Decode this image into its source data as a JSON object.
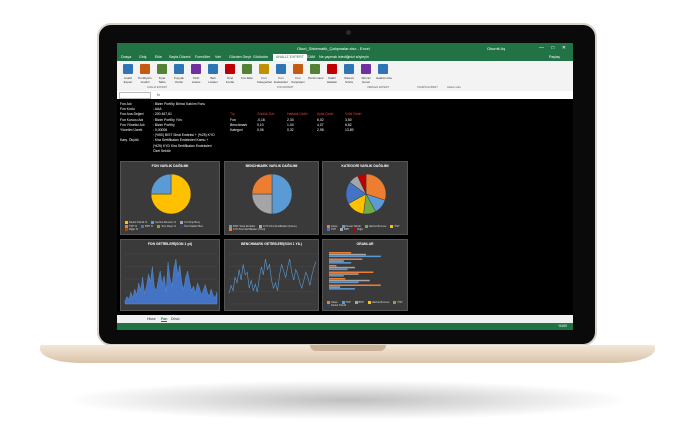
{
  "window": {
    "title": "Okuri_Sistematik_Çalışmalar.xlsx - Excel",
    "user": "Okumit Aş",
    "controls": "— □ ✕"
  },
  "ribbon": {
    "tabs": [
      "Dosya",
      "Giriş",
      "Ekle",
      "Sayfa Düzeni",
      "Formüller",
      "Veri",
      "Gözden Geçir",
      "Görünüm",
      "ANALİZ EXPERT",
      "TEAM"
    ],
    "active_tab": "ANALİZ EXPERT",
    "tell_me": "Ne yapmak istediğinizi söyleyin",
    "share": "Paylaş",
    "buttons": [
      {
        "label": "Analiz Expert",
        "icon": "chart-icon",
        "color": "#2e75b6"
      },
      {
        "label": "Portföyüm Analizi",
        "icon": "pie-icon",
        "color": "#c55a11"
      },
      {
        "label": "Fiyat Tablo",
        "icon": "table-icon",
        "color": "#548235"
      },
      {
        "label": "Kopyalı Veriler",
        "icon": "copy-icon",
        "color": "#2e75b6"
      },
      {
        "label": "Tarih Listesi",
        "icon": "calendar-icon",
        "color": "#7030a0"
      },
      {
        "label": "Beli Listeler",
        "icon": "list-icon",
        "color": "#2e75b6"
      },
      {
        "label": "Özel Fonlar",
        "icon": "star-icon",
        "color": "#c00000"
      },
      {
        "label": "Fon Ekle",
        "icon": "plus-icon",
        "color": "#548235"
      },
      {
        "label": "Fon Kategorileri",
        "icon": "folder-icon",
        "color": "#bf9000"
      },
      {
        "label": "Fon Endeksleri",
        "icon": "index-icon",
        "color": "#2e75b6"
      },
      {
        "label": "Fon Karşılaştır",
        "icon": "compare-icon",
        "color": "#c55a11"
      },
      {
        "label": "Performans",
        "icon": "trend-icon",
        "color": "#548235"
      },
      {
        "label": "Kaldır Hataları",
        "icon": "error-icon",
        "color": "#c00000"
      },
      {
        "label": "Sistemi Sıfırla",
        "icon": "reset-icon",
        "color": "#2e75b6"
      },
      {
        "label": "Tahmin Genel",
        "icon": "forecast-icon",
        "color": "#7030a0"
      },
      {
        "label": "Hakkımızda",
        "icon": "info-icon",
        "color": "#2e75b6"
      }
    ],
    "groups": [
      "ANALİZ EXPERT",
      "FON EXPERT",
      "VERİLER EXPERT",
      "TAHMİN EXPERT",
      "Hakkımızda"
    ]
  },
  "formula_bar": {
    "fx": "fx"
  },
  "fund_info": {
    "rows": [
      {
        "label": "Fon Adı",
        "value": ": Bizim Portföy Birinci Katılım Fonu"
      },
      {
        "label": "Fon Kodu",
        "value": ": AAA"
      },
      {
        "label": "Fon Ana Değeri",
        "value": ": 200.467,61"
      },
      {
        "label": "Fon Kurucu Adı",
        "value": ": Bizim Portföy Yön."
      },
      {
        "label": "Fon Yönetici Adı",
        "value": ": Bizim Portföy"
      },
      {
        "label": "Yönetim Ücreti",
        "value": ": 0,00006"
      },
      {
        "label": "",
        "value": ": (%50) BIST Sinai Endeksi + (%25) KYD"
      },
      {
        "label": "Karş. Ölçütü",
        "value": ": Kira Sertifikaları Endeksleri Kamu +"
      },
      {
        "label": "",
        "value": "(%25) KYD Kira Sertifikaları Endeksleri"
      },
      {
        "label": "",
        "value": "Özel Sektör"
      }
    ]
  },
  "returns": {
    "headers": [
      "Tip",
      "Günlük Get.",
      "Haftalık Getiri",
      "Aylık Getiri",
      "Yıllık Getiri"
    ],
    "rows": [
      [
        "Fon",
        "-0,18",
        "2,34",
        "6,02",
        "3,50"
      ],
      [
        "Benchmark",
        "0,10",
        "1,04",
        "4,07",
        "6,82"
      ],
      [
        "Kategori",
        "0,06",
        "0,32",
        "2,98",
        "13,89"
      ]
    ]
  },
  "panels": {
    "fon_varlik": {
      "title": "FON VARLIK DAĞILIMI",
      "legend": [
        "Devlet Tahvili %",
        "Hazine Bonosu %",
        "Yurt Dışı Borç.",
        "TPP %",
        "BPP %",
        "Ters Repo %",
        "Özel Sektör Bon.",
        "Diğer %"
      ]
    },
    "benchmark_varlik": {
      "title": "BENCHMARK VARLIK DAĞILIMI",
      "legend": [
        "BIST Sinai Endeksi",
        "KYD Kira Sertifikaları (Kamu)",
        "KYD Kira Sertifikaları (Özel)"
      ]
    },
    "kategori_varlik": {
      "title": "KATEGORİ VARLIK DAĞILIMI",
      "legend": [
        "Hisse",
        "Devlet Tahvili",
        "Hazine Bonosu",
        "ÖST",
        "TPP",
        "BPP",
        "Diğer"
      ]
    },
    "fon_getiri": {
      "title": "FON GETİRİLERİ(SON 1 yıl)"
    },
    "benchmark_getiri": {
      "title": "BENCHMARK GETİRİLERİ(SON 1 YIL)"
    },
    "oranlar": {
      "title": "ORANLAR",
      "legend": [
        "Hisse",
        "TPP",
        "BPP",
        "Hazine Bonosu",
        "ÖST",
        "Devlet Tahvili"
      ]
    }
  },
  "sheet_tabs": [
    "Hisse",
    "Fon",
    "Döviz"
  ],
  "active_sheet": "Fon",
  "status": {
    "zoom": "%100"
  },
  "colors": {
    "excel_green": "#217346",
    "blue": "#5b9bd5",
    "orange": "#ed7d31",
    "gray": "#a5a5a5",
    "yellow": "#ffc000",
    "green": "#70ad47",
    "red": "#e94040"
  },
  "chart_data": [
    {
      "type": "pie",
      "title": "FON VARLIK DAĞILIMI",
      "categories": [
        "Devlet Tahvili %",
        "Hazine Bonosu %"
      ],
      "values": [
        75,
        25
      ]
    },
    {
      "type": "pie",
      "title": "BENCHMARK VARLIK DAĞILIMI",
      "categories": [
        "BIST Sinai Endeksi",
        "KYD Kira Sertifikaları (Kamu)",
        "KYD Kira Sertifikaları (Özel)"
      ],
      "values": [
        50,
        25,
        25
      ]
    },
    {
      "type": "pie",
      "title": "KATEGORİ VARLIK DAĞILIMI",
      "categories": [
        "Hisse",
        "Devlet Tahvili",
        "Hazine Bonosu",
        "ÖST",
        "TPP",
        "BPP",
        "Diğer"
      ],
      "values": [
        30,
        12,
        10,
        15,
        18,
        8,
        7
      ]
    },
    {
      "type": "area",
      "title": "FON GETİRİLERİ(SON 1 yıl)",
      "values": [
        2,
        5,
        3,
        8,
        4,
        10,
        6,
        14,
        9,
        18,
        7,
        12,
        20,
        15,
        25,
        11,
        9,
        16,
        22,
        13,
        19,
        8,
        28,
        17,
        12,
        24,
        30,
        19,
        26,
        14,
        10,
        18,
        22,
        15,
        9,
        12,
        7,
        14,
        11,
        6,
        9,
        13,
        8,
        5,
        10,
        6,
        4,
        8
      ]
    },
    {
      "type": "line",
      "title": "BENCHMARK GETİRİLERİ(SON 1 YIL)",
      "values": [
        8,
        14,
        10,
        20,
        16,
        26,
        18,
        30,
        22,
        24,
        12,
        18,
        10,
        15,
        9,
        20,
        28,
        22,
        34,
        26,
        30,
        18,
        12,
        16,
        10,
        22,
        30,
        25,
        20,
        28,
        34,
        24,
        18,
        26,
        22,
        16,
        12,
        18,
        24,
        20,
        14,
        22,
        28,
        32
      ]
    },
    {
      "type": "bar",
      "title": "ORANLAR",
      "categories": [
        "Hisse",
        "TPP",
        "BPP",
        "Hazine Bonosu",
        "ÖST",
        "Devlet Tahvili"
      ],
      "series": [
        {
          "name": "Fon",
          "values": [
            30,
            45,
            10,
            60,
            22,
            70
          ]
        },
        {
          "name": "Benchmark",
          "values": [
            50,
            20,
            35,
            40,
            55,
            15
          ]
        },
        {
          "name": "Kategori",
          "values": [
            70,
            30,
            25,
            20,
            40,
            35
          ]
        }
      ]
    }
  ]
}
